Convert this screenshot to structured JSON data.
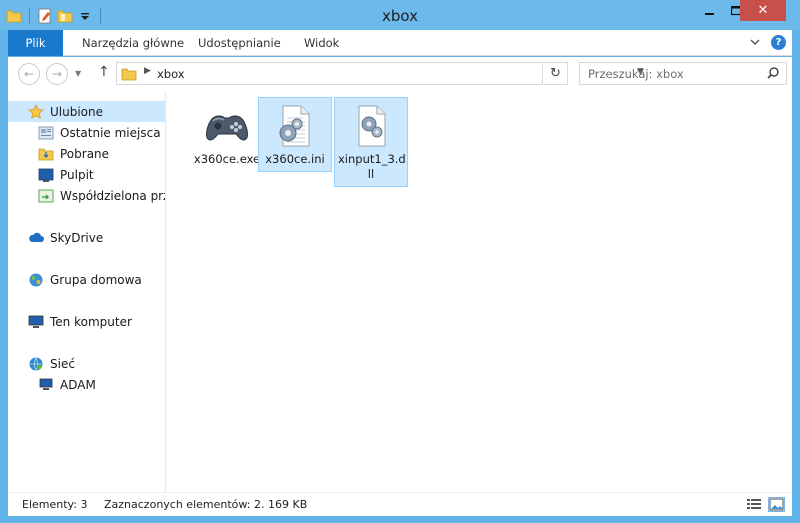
{
  "window": {
    "title": "xbox",
    "close_label": "✕",
    "minimize_label": "—",
    "maximize_label": "☐"
  },
  "ribbon": {
    "tabs": [
      {
        "label": "Plik"
      },
      {
        "label": "Narzędzia główne"
      },
      {
        "label": "Udostępnianie"
      },
      {
        "label": "Widok"
      }
    ],
    "help_label": "?"
  },
  "address": {
    "path": "xbox",
    "search_placeholder": "Przeszukaj: xbox"
  },
  "nav": {
    "favorites": {
      "label": "Ulubione",
      "items": [
        {
          "label": "Ostatnie miejsca"
        },
        {
          "label": "Pobrane"
        },
        {
          "label": "Pulpit"
        },
        {
          "label": "Współdzielona przes"
        }
      ]
    },
    "skydrive": "SkyDrive",
    "homegroup": "Grupa domowa",
    "computer": "Ten komputer",
    "network": {
      "label": "Sieć",
      "items": [
        {
          "label": "ADAM"
        }
      ]
    }
  },
  "files": [
    {
      "name": "x360ce.exe",
      "icon": "gamepad-icon",
      "selected": false
    },
    {
      "name": "x360ce.ini",
      "icon": "config-file-icon",
      "selected": true
    },
    {
      "name": "xinput1_3.dll",
      "name_line1": "xinput1_3.d",
      "name_line2": "ll",
      "icon": "dll-file-icon",
      "selected": true
    }
  ],
  "status": {
    "count": "Elementy: 3",
    "selection": "Zaznaczonych elementów: 2. 169 KB"
  },
  "colors": {
    "titlebar": "#6cbaeb",
    "accent": "#1979ca",
    "selection": "#cce8ff",
    "selection_border": "#99d1ff",
    "close": "#c7514a"
  }
}
